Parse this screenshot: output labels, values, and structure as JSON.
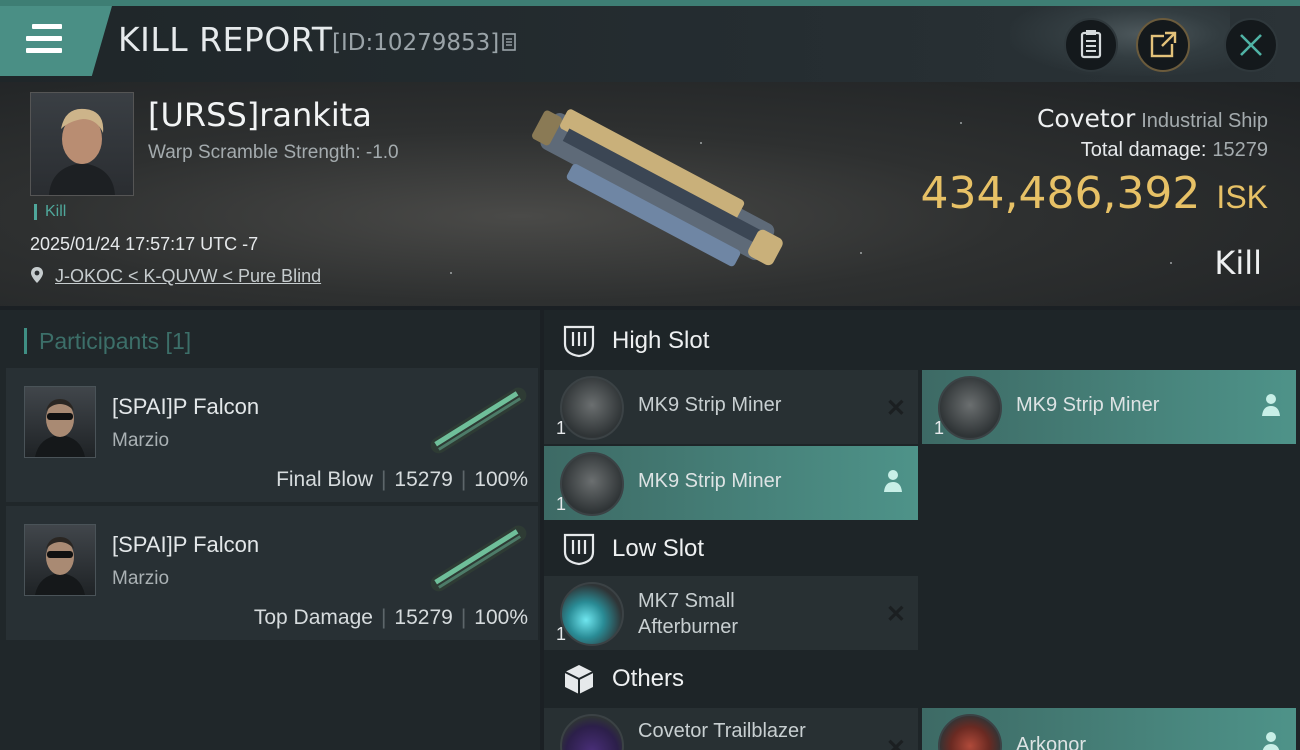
{
  "header": {
    "title": "KILL REPORT",
    "report_id": "[ID:10279853]"
  },
  "victim": {
    "name": "[URSS]rankita",
    "warp_scramble": "Warp Scramble Strength: -1.0",
    "tag": "Kill",
    "datetime": "2025/01/24 17:57:17 UTC -7",
    "location": "J-OKOC < K-QUVW < Pure Blind"
  },
  "ship": {
    "name": "Covetor",
    "class": "Industrial Ship",
    "total_damage_label": "Total damage:",
    "total_damage": "15279",
    "isk_value": "434,486,392",
    "isk_unit": "ISK",
    "result": "Kill"
  },
  "participants": {
    "header": "Participants [1]",
    "items": [
      {
        "name": "[SPAI]P Falcon",
        "ship": "Marzio",
        "role": "Final Blow",
        "damage": "15279",
        "percent": "100%"
      },
      {
        "name": "[SPAI]P Falcon",
        "ship": "Marzio",
        "role": "Top Damage",
        "damage": "15279",
        "percent": "100%"
      }
    ]
  },
  "sections": {
    "high": {
      "title": "High Slot",
      "slots": [
        {
          "name": "MK9 Strip Miner",
          "qty": "1",
          "status": "destroyed"
        },
        {
          "name": "MK9 Strip Miner",
          "qty": "1",
          "status": "dropped"
        },
        {
          "name": "MK9 Strip Miner",
          "qty": "1",
          "status": "dropped"
        }
      ]
    },
    "low": {
      "title": "Low Slot",
      "slots": [
        {
          "name": "MK7 Small Afterburner",
          "line1": "MK7 Small",
          "line2": "Afterburner",
          "qty": "1",
          "status": "destroyed"
        }
      ]
    },
    "others": {
      "title": "Others",
      "slots": [
        {
          "name": "Covetor Trailblazer",
          "status": "destroyed"
        },
        {
          "name": "Arkonor",
          "status": "dropped"
        }
      ]
    }
  },
  "colors": {
    "accent": "#4a8f85",
    "isk": "#e7c166",
    "dropped_highlight": "#4e9389"
  }
}
